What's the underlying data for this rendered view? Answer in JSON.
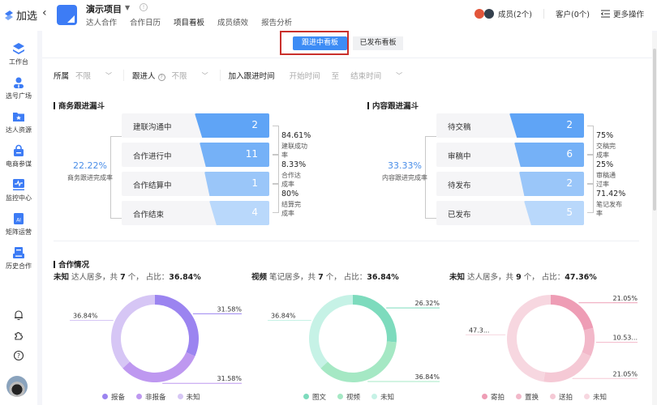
{
  "app": {
    "logo_text": "加选"
  },
  "sidebar": {
    "items": [
      {
        "label": "工作台",
        "icon": "workspace-icon"
      },
      {
        "label": "选号广场",
        "icon": "user-select-icon"
      },
      {
        "label": "达人资源",
        "icon": "folder-star-icon"
      },
      {
        "label": "电商参谋",
        "icon": "shopping-bag-icon"
      },
      {
        "label": "监控中心",
        "icon": "monitor-icon"
      },
      {
        "label": "矩阵运营",
        "icon": "ai-icon"
      },
      {
        "label": "历史合作",
        "icon": "history-icon"
      }
    ],
    "bottom_icons": [
      "bell-icon",
      "puzzle-icon",
      "help-icon"
    ]
  },
  "header": {
    "project_title": "演示项目",
    "tabs": [
      "达人合作",
      "合作日历",
      "项目看板",
      "成员绩效",
      "报告分析"
    ],
    "active_tab": "项目看板",
    "members_label": "成员(2个)",
    "customers_label": "客户(0个)",
    "more_label": "更多操作"
  },
  "board_switch": {
    "active": "跟进中看板",
    "inactive": "已发布看板"
  },
  "filters": {
    "owner_label": "所属",
    "owner_value": "不限",
    "follower_label": "跟进人",
    "follower_value": "不限",
    "time_label": "加入跟进时间",
    "start_placeholder": "开始时间",
    "to": "至",
    "end_placeholder": "结束时间"
  },
  "business_funnel": {
    "title": "商务跟进漏斗",
    "total_pct": "22.22%",
    "total_label": "商务跟进完成率",
    "stages": [
      {
        "name": "建联沟通中",
        "value": "2"
      },
      {
        "name": "合作进行中",
        "value": "11"
      },
      {
        "name": "合作结算中",
        "value": "1"
      },
      {
        "name": "合作结束",
        "value": "4"
      }
    ],
    "rates": [
      {
        "pct": "84.61%",
        "label": "建联成功率"
      },
      {
        "pct": "8.33%",
        "label": "合作达成率"
      },
      {
        "pct": "80%",
        "label": "结算完成率"
      }
    ]
  },
  "content_funnel": {
    "title": "内容跟进漏斗",
    "total_pct": "33.33%",
    "total_label": "内容跟进完成率",
    "stages": [
      {
        "name": "待交稿",
        "value": "2"
      },
      {
        "name": "审稿中",
        "value": "6"
      },
      {
        "name": "待发布",
        "value": "2"
      },
      {
        "name": "已发布",
        "value": "5"
      }
    ],
    "rates": [
      {
        "pct": "75%",
        "label": "交稿完成率"
      },
      {
        "pct": "25%",
        "label": "审稿通过率"
      },
      {
        "pct": "71.42%",
        "label": "笔记发布率"
      }
    ]
  },
  "cooperation": {
    "title": "合作情况",
    "charts": [
      {
        "lead": "未知",
        "mid": " 达人居多，共 ",
        "count": "7",
        "tail": " 个， 占比：",
        "pct": "36.84%",
        "slices": [
          {
            "name": "报备",
            "value": 31.58,
            "label": "31.58%",
            "color": "#9b84f0"
          },
          {
            "name": "非报备",
            "value": 31.58,
            "label": "31.58%",
            "color": "#be98f0"
          },
          {
            "name": "未知",
            "value": 36.84,
            "label": "36.84%",
            "color": "#d6c6f5"
          }
        ]
      },
      {
        "lead": "视频",
        "mid": " 笔记居多，共 ",
        "count": "7",
        "tail": " 个， 占比：",
        "pct": "36.84%",
        "slices": [
          {
            "name": "图文",
            "value": 26.32,
            "label": "26.32%",
            "color": "#7ddbbd"
          },
          {
            "name": "视频",
            "value": 36.84,
            "label": "36.84%",
            "color": "#a5e8c4"
          },
          {
            "name": "未知",
            "value": 36.84,
            "label": "36.84%",
            "color": "#c6f2e6"
          }
        ]
      },
      {
        "lead": "未知",
        "mid": " 达人居多，共 ",
        "count": "9",
        "tail": " 个， 占比：",
        "pct": "47.36%",
        "slices": [
          {
            "name": "寄拍",
            "value": 21.05,
            "label": "21.05%",
            "color": "#ee9db5"
          },
          {
            "name": "置换",
            "value": 10.53,
            "label": "10.53...",
            "color": "#f2b8c9"
          },
          {
            "name": "送拍",
            "value": 21.05,
            "label": "21.05%",
            "color": "#f5c9d5"
          },
          {
            "name": "未知",
            "value": 47.36,
            "label": "47.3...",
            "color": "#f7d7e0"
          }
        ]
      }
    ]
  },
  "colors": {
    "primary": "#3d8cf5",
    "highlight_border": "#c9302c"
  }
}
